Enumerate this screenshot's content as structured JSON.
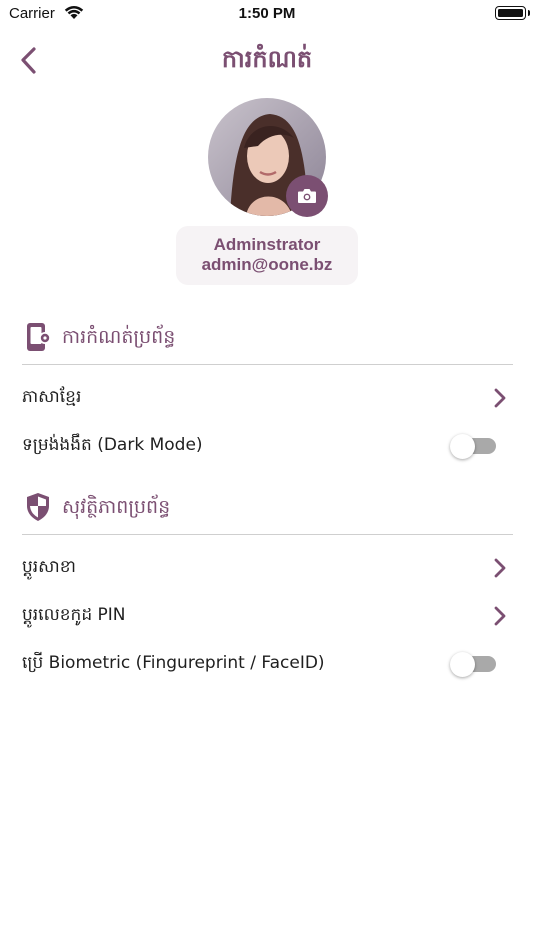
{
  "status_bar": {
    "carrier": "Carrier",
    "time": "1:50 PM"
  },
  "nav": {
    "title": "ការកំណត់"
  },
  "profile": {
    "name": "Adminstrator",
    "email": "admin@oone.bz"
  },
  "sections": [
    {
      "title": "ការកំណត់ប្រព័ន្ធ",
      "icon": "device-settings-icon",
      "rows": [
        {
          "label": "ភាសាខ្មែរ",
          "control": "chevron"
        },
        {
          "label": "ទម្រង់ងងឹត (Dark Mode)",
          "control": "toggle",
          "value": false
        }
      ]
    },
    {
      "title": "សុវត្ថិភាពប្រព័ន្ធ",
      "icon": "shield-icon",
      "rows": [
        {
          "label": "ប្តូរសាខា",
          "control": "chevron"
        },
        {
          "label": "ប្តូរលេខកូដ PIN",
          "control": "chevron"
        },
        {
          "label": "ប្រើ Biometric (Fingureprint / FaceID)",
          "control": "toggle",
          "value": false
        }
      ]
    }
  ],
  "colors": {
    "accent": "#7b4f72",
    "card_bg": "#f6f3f5",
    "divider": "#cfcfcf",
    "toggle_off": "#a9a9a9"
  }
}
